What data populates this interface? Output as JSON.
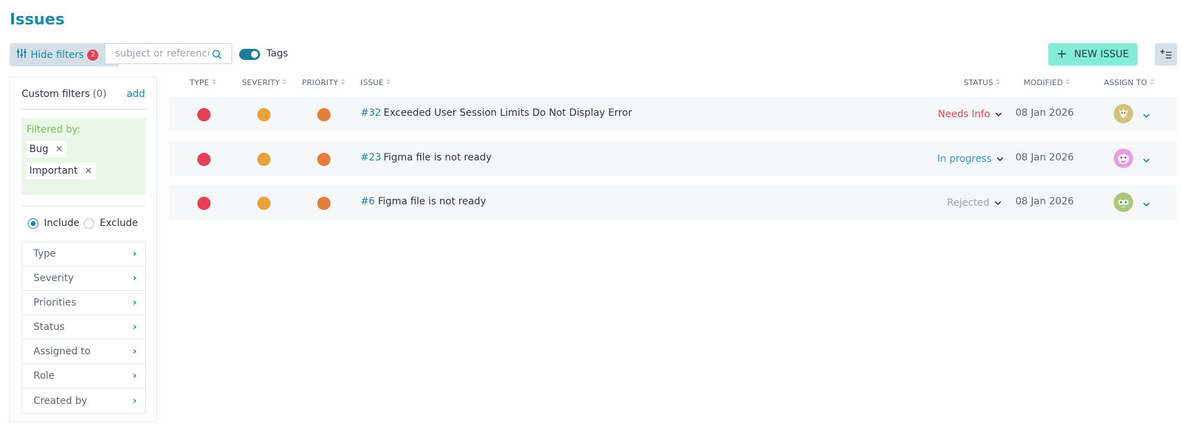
{
  "page": {
    "title": "Issues"
  },
  "toolbar": {
    "hide_filters_label": "Hide filters",
    "filters_count": "2",
    "search_placeholder": "subject or reference",
    "tags_label": "Tags",
    "tags_enabled": true,
    "new_issue_label": "NEW ISSUE"
  },
  "filters": {
    "custom_title": "Custom filters",
    "custom_count": "(0)",
    "add_label": "add",
    "filtered_by_label": "Filtered by:",
    "chips": [
      {
        "label": "Bug"
      },
      {
        "label": "Important"
      }
    ],
    "include_label": "Include",
    "exclude_label": "Exclude",
    "selected_mode": "Include",
    "categories": [
      {
        "label": "Type"
      },
      {
        "label": "Severity"
      },
      {
        "label": "Priorities"
      },
      {
        "label": "Status"
      },
      {
        "label": "Assigned to"
      },
      {
        "label": "Role"
      },
      {
        "label": "Created by"
      }
    ]
  },
  "table": {
    "headers": {
      "type": "TYPE",
      "severity": "SEVERITY",
      "priority": "PRIORITY",
      "issue": "ISSUE",
      "status": "STATUS",
      "modified": "MODIFIED",
      "assign_to": "ASSIGN TO"
    },
    "rows": [
      {
        "ref": "#32",
        "subject": "Exceeded User Session Limits Do Not Display Error",
        "status": "Needs Info",
        "status_color": "#e44057",
        "modified": "08 Jan 2026",
        "type_color": "#e44057",
        "severity_color": "#e9a23b",
        "priority_color": "#e47c3b",
        "avatar_color": "#d2c27c"
      },
      {
        "ref": "#23",
        "subject": "Figma file is not ready",
        "status": "In progress",
        "status_color": "#2e9bd6",
        "modified": "08 Jan 2026",
        "type_color": "#e44057",
        "severity_color": "#e9a23b",
        "priority_color": "#e47c3b",
        "avatar_color": "#e79be0"
      },
      {
        "ref": "#6",
        "subject": "Figma file is not ready",
        "status": "Rejected",
        "status_color": "#98a2ab",
        "modified": "08 Jan 2026",
        "type_color": "#e44057",
        "severity_color": "#e9a23b",
        "priority_color": "#e47c3b",
        "avatar_color": "#a7c77a"
      }
    ]
  }
}
